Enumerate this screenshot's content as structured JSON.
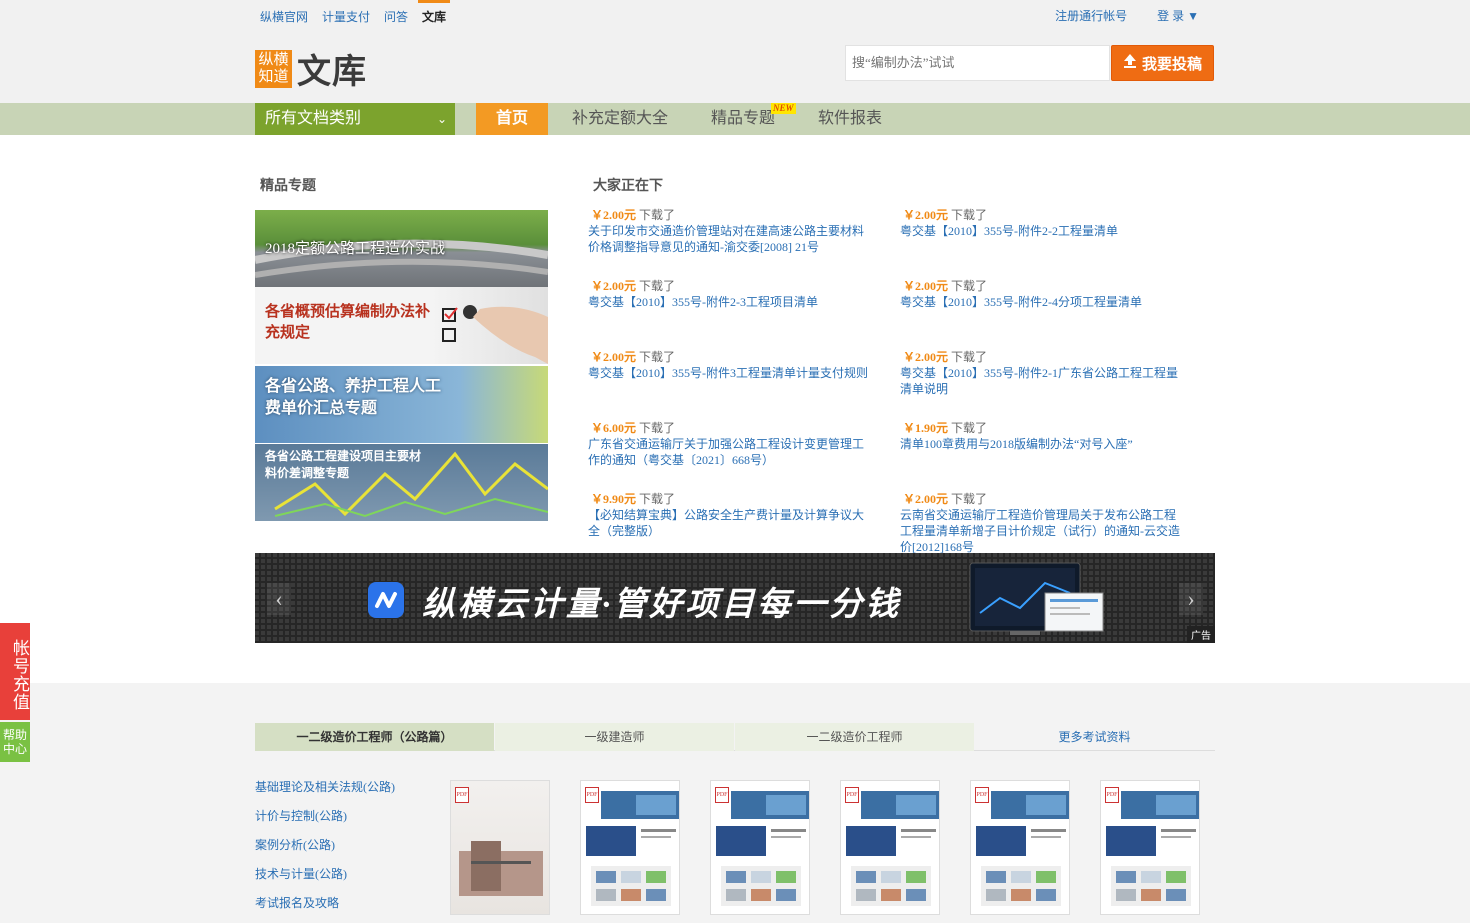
{
  "top_nav": [
    "纵横官网",
    "计量支付",
    "问答",
    "文库"
  ],
  "user_links": {
    "register": "注册通行帐号",
    "login": "登 录 ▼"
  },
  "logo": {
    "badge_line1": "纵横",
    "badge_line2": "知道",
    "text": "文库"
  },
  "search": {
    "placeholder": "搜“编制办法”试试"
  },
  "submit_button": {
    "label": "我要投稿",
    "icon": "upload-icon"
  },
  "category_select": {
    "label": "所有文档类别"
  },
  "main_nav": {
    "home": "首页",
    "items": [
      "补充定额大全",
      "精品专题",
      "软件报表"
    ],
    "new_badge": "NEW"
  },
  "featured": {
    "title": "精品专题",
    "topics": [
      "2018定额公路工程造价实战",
      "各省概预估算编制办法补充规定",
      "各省公路、养护工程人工费单价汇总专题",
      "各省公路工程建设项目主要材料价差调整专题"
    ]
  },
  "downloads": {
    "title": "大家正在下",
    "meta_suffix": "下载了",
    "items": [
      {
        "price": "￥2.00元",
        "title": "关于印发市交通造价管理站对在建高速公路主要材料价格调整指导意见的通知-渝交委[2008] 21号"
      },
      {
        "price": "￥2.00元",
        "title": "粤交基【2010】355号-附件2-2工程量清单"
      },
      {
        "price": "￥2.00元",
        "title": "粤交基【2010】355号-附件2-3工程项目清单"
      },
      {
        "price": "￥2.00元",
        "title": "粤交基【2010】355号-附件2-4分项工程量清单"
      },
      {
        "price": "￥2.00元",
        "title": "粤交基【2010】355号-附件3工程量清单计量支付规则"
      },
      {
        "price": "￥2.00元",
        "title": "粤交基【2010】355号-附件2-1广东省公路工程工程量清单说明"
      },
      {
        "price": "￥6.00元",
        "title": "广东省交通运输厅关于加强公路工程设计变更管理工作的通知（粤交基〔2021〕668号）"
      },
      {
        "price": "￥1.90元",
        "title": "清单100章费用与2018版编制办法“对号入座”"
      },
      {
        "price": "￥9.90元",
        "title": "【必知结算宝典】公路安全生产费计量及计算争议大全（完整版）"
      },
      {
        "price": "￥2.00元",
        "title": "云南省交通运输厅工程造价管理局关于发布公路工程工程量清单新增子目计价规定（试行）的通知-云交造价[2012]168号"
      }
    ]
  },
  "banner": {
    "text": "纵横云计量·管好项目每一分钱",
    "ad_label": "广告"
  },
  "exam_tabs": [
    "一二级造价工程师（公路篇）",
    "一级建造师",
    "一二级造价工程师",
    "更多考试资料"
  ],
  "side_links": [
    "基础理论及相关法规(公路)",
    "计价与控制(公路)",
    "案例分析(公路)",
    "技术与计量(公路)",
    "考试报名及攻略"
  ],
  "float_buttons": {
    "recharge": "帐号充值",
    "help": "帮助中心"
  },
  "colors": {
    "accent_orange": "#f08a16",
    "nav_green": "#7ca32d",
    "link_blue": "#2a6fb4"
  }
}
